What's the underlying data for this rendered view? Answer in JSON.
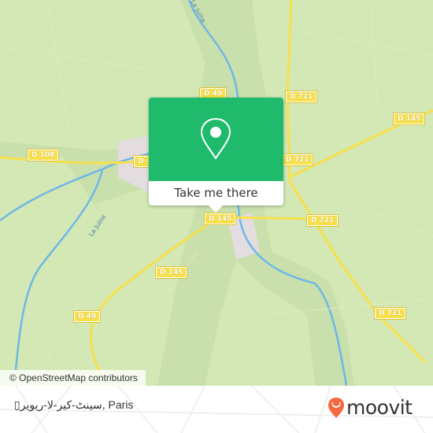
{
  "map": {
    "road_labels": [
      "D 49",
      "D 721",
      "D 145",
      "D 108",
      "D 4",
      "D 721",
      "D 145",
      "D 721",
      "D 145",
      "D 49",
      "D 721"
    ],
    "river_labels": [
      "La Juine",
      "La Juine"
    ],
    "colors": {
      "land": "#d3e8b5",
      "road": "#f7e04a",
      "river": "#6fb7e6",
      "popup": "#1fba6c"
    }
  },
  "popup": {
    "icon": "map-pin-icon",
    "button_label": "Take me there"
  },
  "attribution": "© OpenStreetMap contributors",
  "footer": {
    "place": "▯سينٹ-كير-لا-ريوير, Paris",
    "brand": "moovit",
    "brand_color": "#f4693f"
  }
}
